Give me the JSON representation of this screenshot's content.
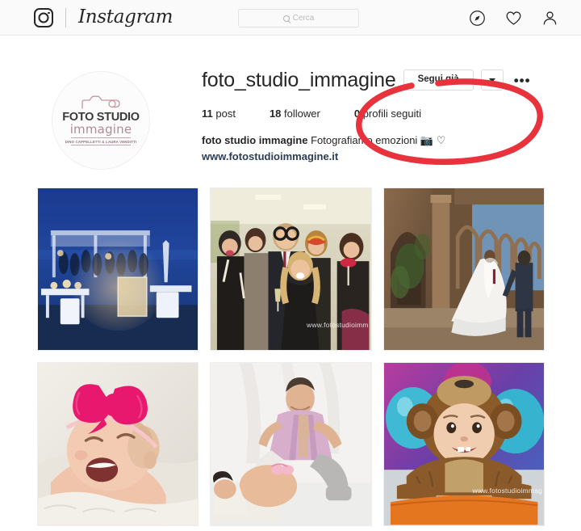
{
  "nav": {
    "brand": "Instagram",
    "brand_icon": "instagram-camera-icon",
    "search_placeholder": "Cerca",
    "search_icon": "search-icon",
    "icons": [
      {
        "name": "compass-explore-icon",
        "label": "Esplora"
      },
      {
        "name": "heart-activity-icon",
        "label": "Attività"
      },
      {
        "name": "person-profile-icon",
        "label": "Profilo"
      }
    ]
  },
  "profile": {
    "username": "foto_studio_immagine",
    "avatar": {
      "name": "profile-avatar",
      "logo_line1": "FOTO STUDIO",
      "logo_line2": "immagine",
      "logo_line3": "DINO CAPPELLETTI & LAURA VENDITTI",
      "logo_icon": "camera-outline-icon",
      "accent_color": "#b08a94"
    },
    "actions": {
      "follow_label": "Segui già",
      "dropdown_icon": "chevron-down-icon",
      "more_label": "•••",
      "more_icon": "ellipsis-icon"
    },
    "stats": [
      {
        "value": "11",
        "label": "post"
      },
      {
        "value": "18",
        "label": "follower"
      },
      {
        "value": "0",
        "label": "profili seguiti"
      }
    ],
    "bio": {
      "name": "foto studio immagine",
      "text": "Fotografiamo emozioni 📷 ♡",
      "website": "www.fotostudioimmagine.it"
    }
  },
  "annotation": {
    "name": "red-ellipse-highlight",
    "color": "#e8323c",
    "shape": "hand-drawn-ellipse",
    "target": "follow-button-area"
  },
  "grid": {
    "posts": [
      {
        "name": "post-beach-wedding-reception",
        "description": "Beach wedding reception at blue hour with lanterns and white chairs",
        "watermark": ""
      },
      {
        "name": "post-photobooth-group",
        "description": "Group of guests with photo-booth props and masks",
        "watermark": "www.fotostudioimm"
      },
      {
        "name": "post-bride-groom-ruins",
        "description": "Bride and groom walking through stone arched ruins",
        "watermark": ""
      },
      {
        "name": "post-newborn-pink-bow",
        "description": "Smiling newborn baby girl with large pink bow headband",
        "watermark": ""
      },
      {
        "name": "post-maternity-couple",
        "description": "Maternity studio portrait of expecting couple with baby shoes",
        "watermark": ""
      },
      {
        "name": "post-toddler-monkey-costume",
        "description": "Toddler in brown monkey costume with colorful balloons",
        "watermark": "www.fotostudioimmag"
      }
    ]
  }
}
